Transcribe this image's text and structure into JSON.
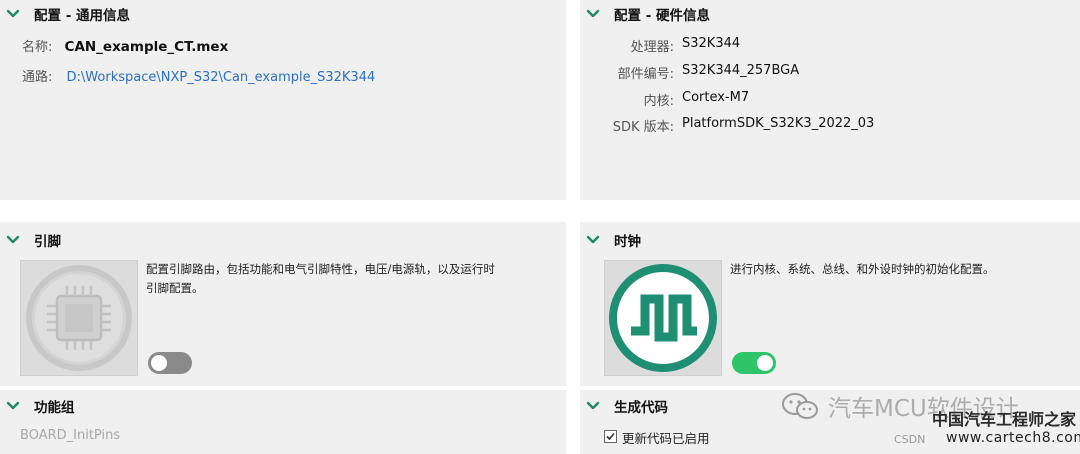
{
  "general": {
    "title": "配置 - 通用信息",
    "name_label": "名称:",
    "name_value": "CAN_example_CT.mex",
    "path_label": "通路:",
    "path_value": "D:\\Workspace\\NXP_S32\\Can_example_S32K344"
  },
  "hardware": {
    "title": "配置 - 硬件信息",
    "rows": [
      {
        "label": "处理器:",
        "value": "S32K344"
      },
      {
        "label": "部件编号:",
        "value": "S32K344_257BGA"
      },
      {
        "label": "内核:",
        "value": "Cortex-M7"
      },
      {
        "label": "SDK 版本:",
        "value": "PlatformSDK_S32K3_2022_03"
      }
    ]
  },
  "pins": {
    "title": "引脚",
    "desc_line1": "配置引脚路由，包括功能和电气引脚特性，电压/电源轨，以及运行时",
    "desc_line2": "引脚配置。",
    "enabled": false
  },
  "clocks": {
    "title": "时钟",
    "desc": "进行内核、系统、总线、和外设时钟的初始化配置。",
    "enabled": true
  },
  "function_group": {
    "title": "功能组",
    "value": "BOARD_InitPins"
  },
  "codegen": {
    "title": "生成代码",
    "checkbox_label": "更新代码已启用",
    "checked": true
  },
  "watermark": {
    "wechat": "汽车MCU软件设计",
    "site_cn": "中国汽车工程师之家",
    "csdn": "CSDN",
    "site_url": "www.cartech8.com"
  },
  "colors": {
    "panel_bg": "#f0f0f0",
    "chevron": "#1f8a6a",
    "link": "#2a6fc9",
    "toggle_on": "#2ec46a",
    "toggle_off": "#8a8a8a",
    "clock_icon": "#1f8f73"
  }
}
